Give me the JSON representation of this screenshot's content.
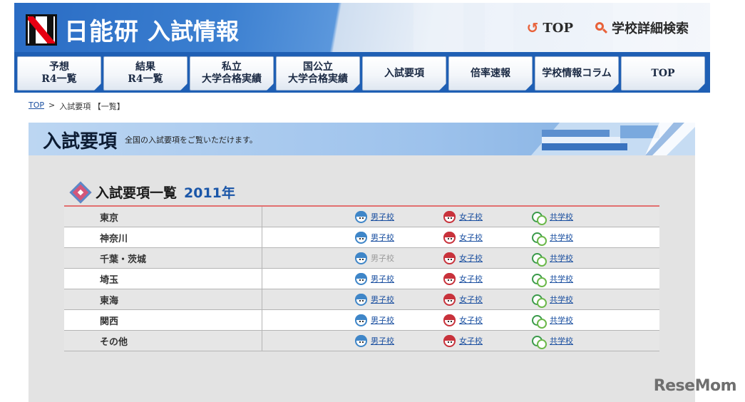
{
  "header": {
    "logo_text": "日能研",
    "logo_sub": "入試情報",
    "top_links": [
      {
        "label": "TOP",
        "icon": "u-turn-icon"
      },
      {
        "label": "学校詳細検索",
        "icon": "search-icon"
      }
    ]
  },
  "nav": [
    {
      "line1": "予想",
      "line2": "R4一覧"
    },
    {
      "line1": "結果",
      "line2": "R4一覧"
    },
    {
      "line1": "私立",
      "line2": "大学合格実績"
    },
    {
      "line1": "国公立",
      "line2": "大学合格実績"
    },
    {
      "line1": "入試要項",
      "line2": ""
    },
    {
      "line1": "倍率速報",
      "line2": ""
    },
    {
      "line1": "学校情報コラム",
      "line2": ""
    },
    {
      "line1": "TOP",
      "line2": ""
    }
  ],
  "breadcrumb": {
    "top": "TOP",
    "sep": ">",
    "current": "入試要項 【一覧】"
  },
  "banner": {
    "title": "入試要項",
    "desc": "全国の入試要項をご覧いただけます。"
  },
  "list": {
    "title": "入試要項一覧",
    "year": "2011年",
    "link_labels": {
      "boys": "男子校",
      "girls": "女子校",
      "coed": "共学校"
    },
    "rows": [
      {
        "region": "東京",
        "boys_enabled": true
      },
      {
        "region": "神奈川",
        "boys_enabled": true
      },
      {
        "region": "千葉・茨城",
        "boys_enabled": false
      },
      {
        "region": "埼玉",
        "boys_enabled": true
      },
      {
        "region": "東海",
        "boys_enabled": true
      },
      {
        "region": "関西",
        "boys_enabled": true
      },
      {
        "region": "その他",
        "boys_enabled": true
      }
    ]
  },
  "watermark": "ReseMom",
  "colors": {
    "header_blue": "#1f5fb4",
    "accent_orange": "#e8623a",
    "link_blue": "#1a4fa0",
    "table_top_border": "#e27070"
  }
}
